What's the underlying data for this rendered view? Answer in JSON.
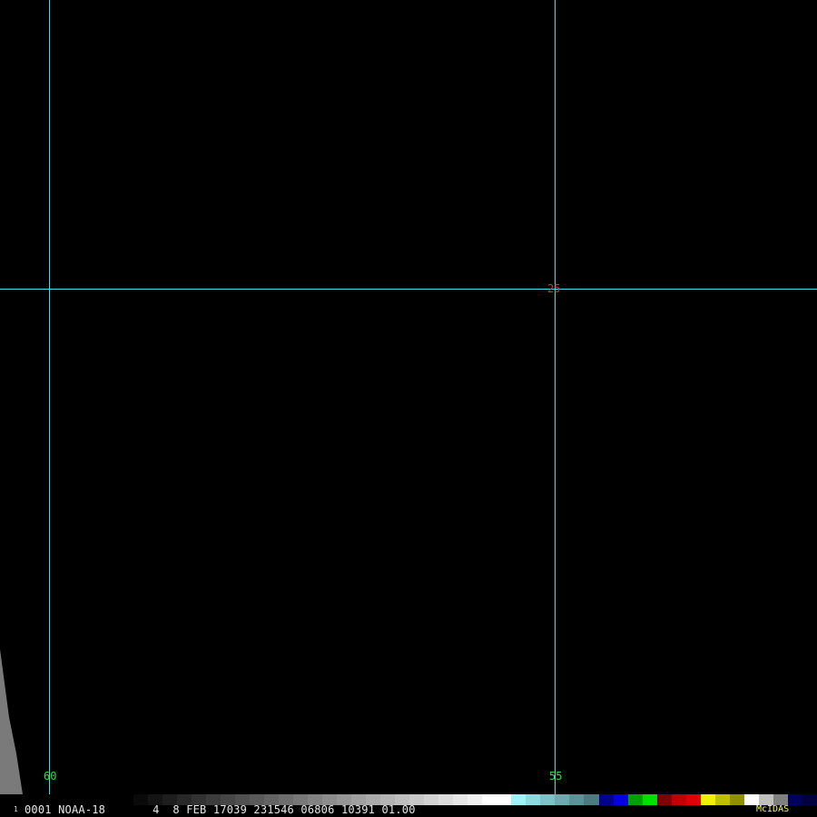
{
  "grid": {
    "line_color": "#40e0e8",
    "latitude_labels": [
      {
        "text": "25",
        "color": "#e03030"
      }
    ],
    "longitude_labels": [
      {
        "text": "60",
        "color": "#30e030"
      },
      {
        "text": "55",
        "color": "#30e030"
      }
    ]
  },
  "imagery": {
    "background_color": "#000000",
    "visible_swath_color": "#7a7a7a"
  },
  "status_bar": {
    "frame_number": "1",
    "info_text": "0001 NOAA-18       4  8 FEB 17039 231546 06806 10391 01.00",
    "brand": "McIDAS",
    "brand_color": "#ffff30",
    "color_bar_colors": [
      "#0a0a0a",
      "#141414",
      "#1e1e1e",
      "#282828",
      "#323232",
      "#3c3c3c",
      "#464646",
      "#505050",
      "#5a5a5a",
      "#646464",
      "#6e6e6e",
      "#787878",
      "#828282",
      "#8c8c8c",
      "#969696",
      "#a0a0a0",
      "#aaaaaa",
      "#b4b4b4",
      "#bebebe",
      "#c8c8c8",
      "#d2d2d2",
      "#dcdcdc",
      "#e6e6e6",
      "#f0f0f0",
      "#ffffff",
      "#ffffff",
      "#9af4f8",
      "#8adce0",
      "#7ac4c8",
      "#6aacb0",
      "#5a9498",
      "#4a7c80",
      "#000090",
      "#0000e0",
      "#00a000",
      "#00e000",
      "#800000",
      "#c00000",
      "#e00000",
      "#f0f000",
      "#c0c000",
      "#909000",
      "#ffffff",
      "#c0c0c0",
      "#808080",
      "#000060",
      "#000040"
    ]
  }
}
